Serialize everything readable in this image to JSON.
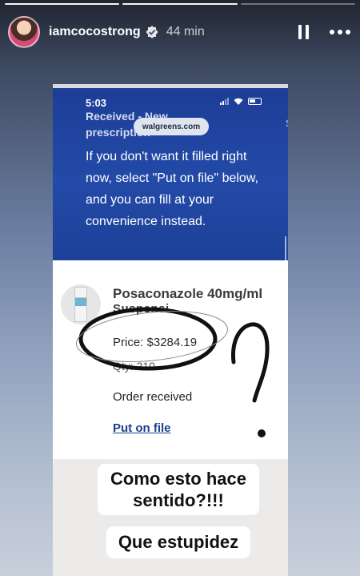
{
  "story": {
    "segments_total": 3,
    "segments_done": 2,
    "username": "iamcocostrong",
    "time_ago": "44 min",
    "icons": {
      "verified": "verified-badge-icon",
      "pause": "pause-icon",
      "more": "more-options-icon"
    }
  },
  "screenshot": {
    "clock": "5:03",
    "faded_header": "Received - New prescription",
    "url": "walgreens.com",
    "side_letter": "S",
    "message": "If you don't want it filled right now, select \"Put on file\" below, and you can fill at your convenience instead.",
    "drug_name": "Posaconazole 40mg/ml",
    "drug_sub": "Suspensi...",
    "price": "Price: $3284.19",
    "qty": "Qty: 210",
    "status": "Order received",
    "action_link": "Put on file"
  },
  "captions": {
    "first": "Como esto hace sentido?!!!",
    "second": "Que estupidez"
  },
  "colors": {
    "header_blue": "#234aa8",
    "link_blue": "#1b3f8f"
  }
}
